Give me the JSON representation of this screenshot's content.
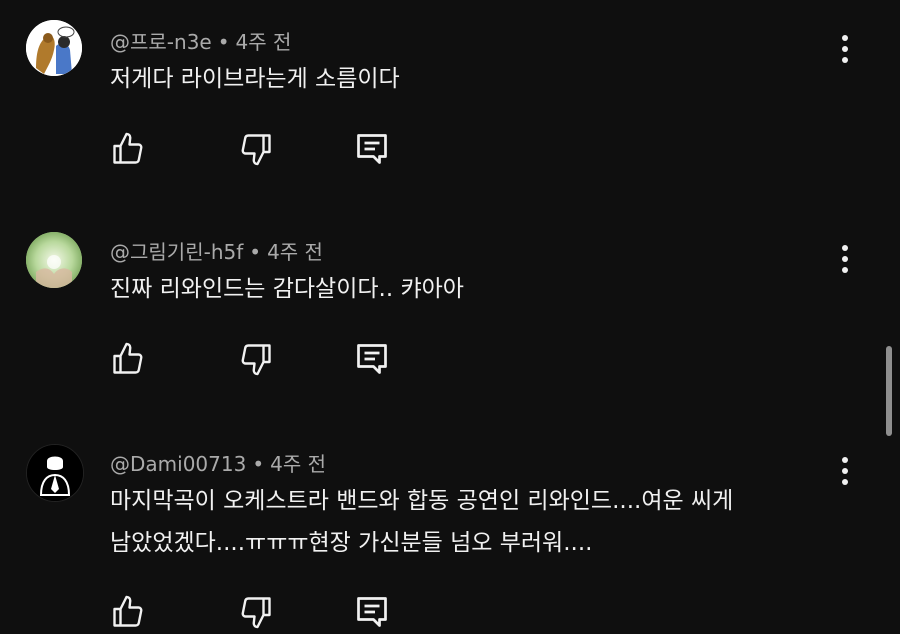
{
  "comments": [
    {
      "author": "@프로-n3e",
      "separator": "•",
      "time": "4주 전",
      "lines": [
        "저게다 라이브라는게 소름이다"
      ]
    },
    {
      "author": "@그림기린-h5f",
      "separator": "•",
      "time": "4주 전",
      "lines": [
        "진짜 리와인드는 감다살이다.. 캬아아"
      ]
    },
    {
      "author": "@Dami00713",
      "separator": "•",
      "time": "4주 전",
      "lines": [
        "마지막곡이 오케스트라 밴드와 합동 공연인 리와인드....여운 씨게",
        "남았었겠다....ㅠㅠㅠ현장 가신분들 넘오 부러워...."
      ]
    }
  ],
  "icons": {
    "like": "thumbs-up-icon",
    "dislike": "thumbs-down-icon",
    "reply": "reply-icon",
    "menu": "more-vert-icon"
  },
  "colors": {
    "background": "#0f0f0f",
    "text": "#f1f1f1",
    "meta": "#aaaaaa"
  }
}
